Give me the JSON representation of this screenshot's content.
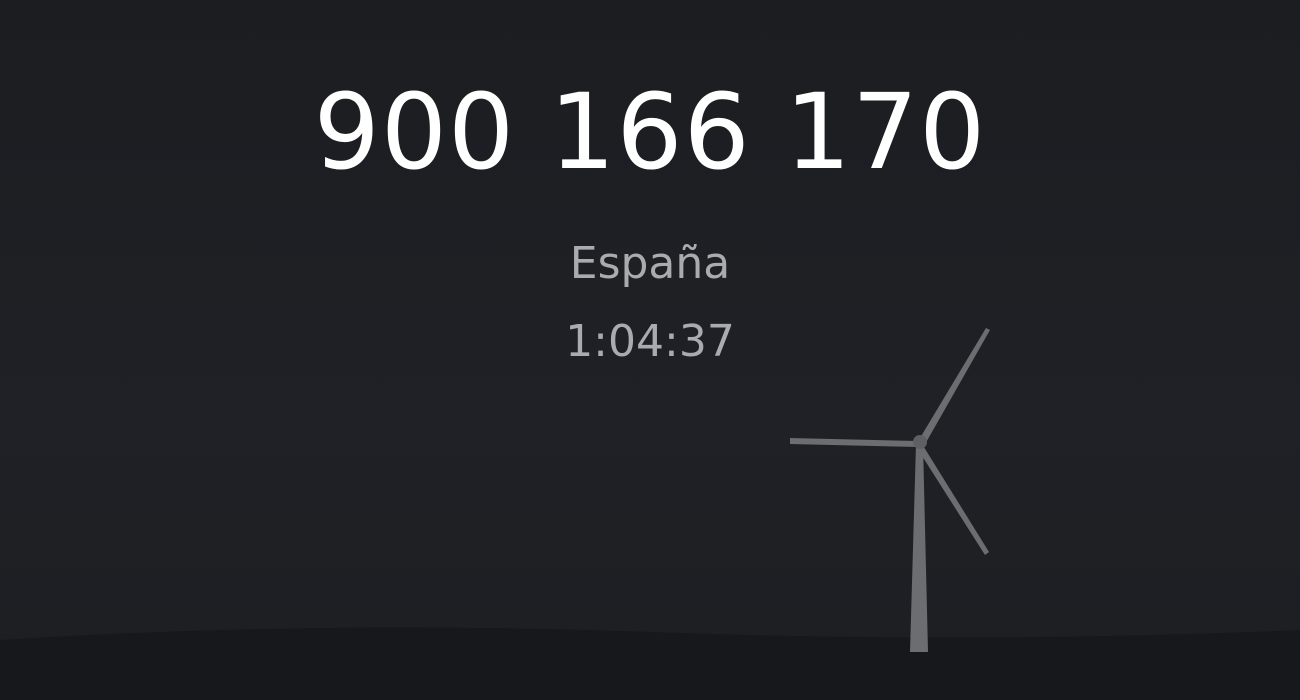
{
  "call": {
    "number": "900 166 170",
    "country": "España",
    "duration": "1:04:37"
  },
  "colors": {
    "background": "#1e2025",
    "number_text": "#ffffff",
    "secondary_text": "#a9abb0",
    "turbine": "#6b6d70",
    "hill": "#16181b"
  },
  "decoration": {
    "icon": "wind-turbine-icon"
  }
}
